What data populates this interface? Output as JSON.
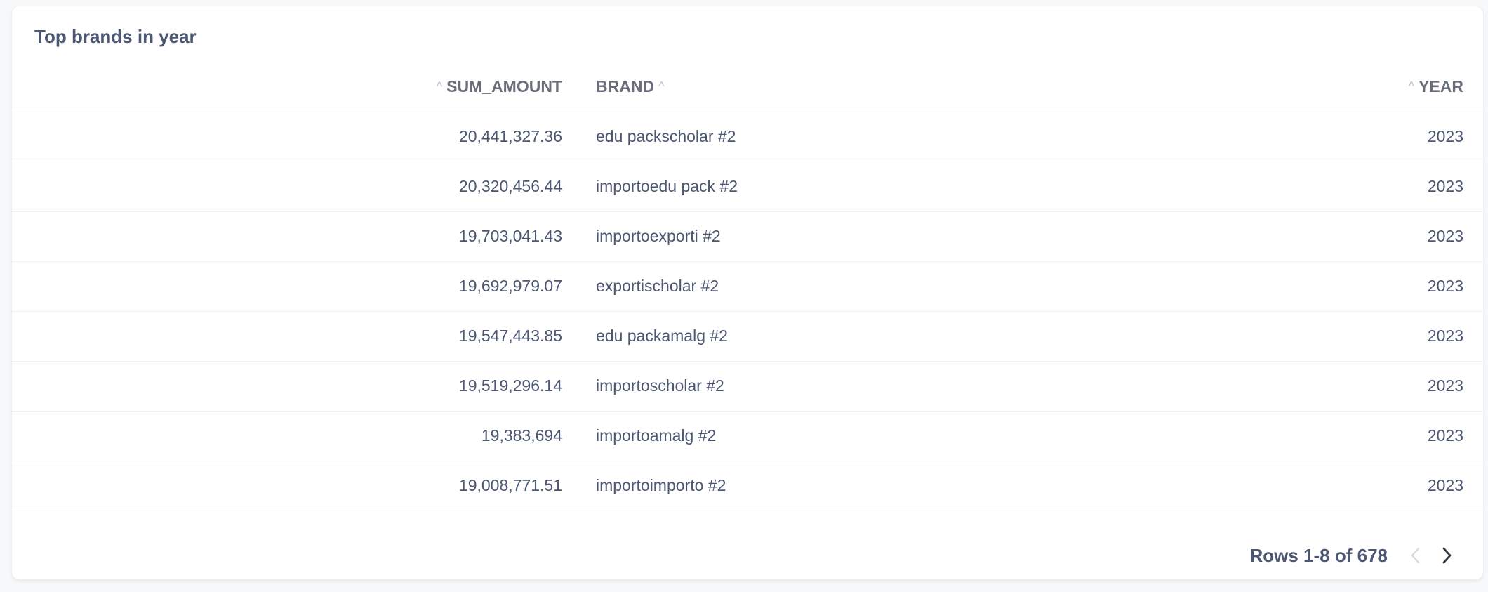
{
  "card": {
    "title": "Top brands in year"
  },
  "table": {
    "columns": [
      {
        "key": "sum_amount",
        "label": "SUM_AMOUNT"
      },
      {
        "key": "brand",
        "label": "BRAND"
      },
      {
        "key": "year",
        "label": "YEAR"
      }
    ],
    "rows": [
      {
        "sum_amount": "20,441,327.36",
        "brand": "edu packscholar #2",
        "year": "2023"
      },
      {
        "sum_amount": "20,320,456.44",
        "brand": "importoedu pack #2",
        "year": "2023"
      },
      {
        "sum_amount": "19,703,041.43",
        "brand": "importoexporti #2",
        "year": "2023"
      },
      {
        "sum_amount": "19,692,979.07",
        "brand": "exportischolar #2",
        "year": "2023"
      },
      {
        "sum_amount": "19,547,443.85",
        "brand": "edu packamalg #2",
        "year": "2023"
      },
      {
        "sum_amount": "19,519,296.14",
        "brand": "importoscholar #2",
        "year": "2023"
      },
      {
        "sum_amount": "19,383,694",
        "brand": "importoamalg #2",
        "year": "2023"
      },
      {
        "sum_amount": "19,008,771.51",
        "brand": "importoimporto #2",
        "year": "2023"
      }
    ]
  },
  "pagination": {
    "label": "Rows 1-8 of 678",
    "prev_icon": "chevron-left-icon",
    "next_icon": "chevron-right-icon",
    "prev_enabled": false,
    "next_enabled": true
  },
  "colors": {
    "text": "#4c5773",
    "header_text": "#696e7b",
    "muted_icon": "#c0c4cc",
    "border": "#f0f0f0",
    "background": "#f7f8fa",
    "card": "#ffffff"
  }
}
